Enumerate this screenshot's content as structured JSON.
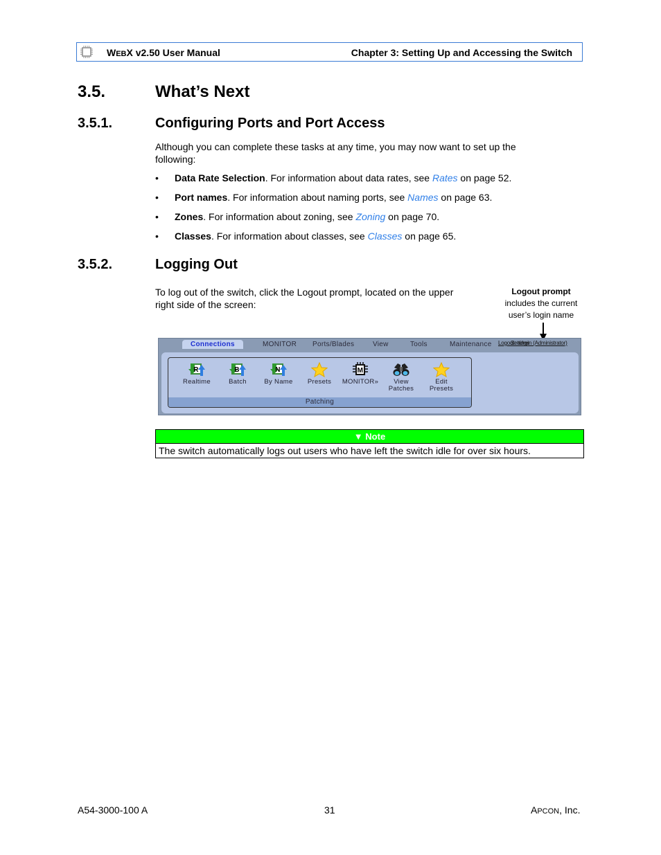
{
  "header": {
    "manual_prefix_cap": "W",
    "manual_prefix_small": "EB",
    "manual_rest": "X v2.50 User Manual",
    "chapter": "Chapter 3: Setting Up and Accessing the Switch",
    "logo_icon": "chip-icon"
  },
  "section": {
    "number": "3.5.",
    "title": "What’s Next"
  },
  "subsection1": {
    "number": "3.5.1.",
    "title": "Configuring Ports and Port Access",
    "intro": "Although you can complete these tasks at any time, you may now want to set up the following:",
    "bullets": [
      {
        "bold": "Data Rate Selection",
        "text": ". For information about data rates, see ",
        "link": "Rates",
        "after": " on page 52."
      },
      {
        "bold": "Port names",
        "text": ". For information about naming ports, see ",
        "link": "Names",
        "after": " on page 63."
      },
      {
        "bold": "Zones",
        "text": ". For information about zoning, see ",
        "link": "Zoning",
        "after": " on page 70."
      },
      {
        "bold": "Classes",
        "text": ". For information about classes, see ",
        "link": "Classes",
        "after": " on page 65."
      }
    ],
    "bullet_glyph": "•"
  },
  "subsection2": {
    "number": "3.5.2.",
    "title": "Logging Out",
    "text": "To log out of the switch, click the Logout prompt, located on the upper right side of the screen:",
    "callout_title": "Logout prompt",
    "callout_line1": "includes the current",
    "callout_line2": "user’s login name"
  },
  "screenshot": {
    "tabs": [
      "Connections",
      "MONITOR",
      "Ports/Blades",
      "View",
      "Tools",
      "Maintenance"
    ],
    "active_tab": "Connections",
    "logout_text": "Logout: admin (Administrator)",
    "logout_overlap": "Settings",
    "group_label": "Patching",
    "tools": [
      {
        "label1": "Realtime",
        "label2": "",
        "icon": "realtime-icon"
      },
      {
        "label1": "Batch",
        "label2": "",
        "icon": "batch-icon"
      },
      {
        "label1": "By Name",
        "label2": "",
        "icon": "by-name-icon"
      },
      {
        "label1": "Presets",
        "label2": "",
        "icon": "star-icon"
      },
      {
        "label1": "MONITOR»",
        "label2": "",
        "icon": "monitor-chip-icon"
      },
      {
        "label1": "View",
        "label2": "Patches",
        "icon": "binoculars-icon"
      },
      {
        "label1": "Edit",
        "label2": "Presets",
        "icon": "star-icon"
      }
    ],
    "tool_letters": [
      "R",
      "B",
      "N"
    ]
  },
  "note": {
    "title": "Note",
    "text": "The switch automatically logs out users who have left the switch idle for over six hours.",
    "header_color": "#00ff00"
  },
  "footer": {
    "doc_number": "A54-3000-100 A",
    "page": "31",
    "company_cap": "A",
    "company_small": "PCON",
    "company_rest": ", Inc."
  }
}
